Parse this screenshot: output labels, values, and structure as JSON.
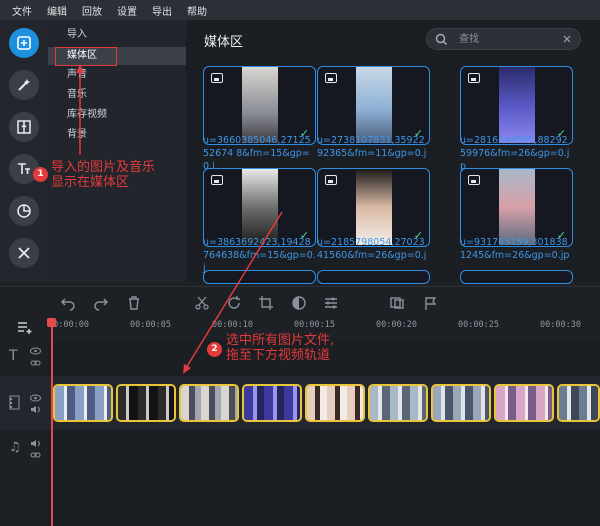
{
  "menu": [
    "文件",
    "编辑",
    "回放",
    "设置",
    "导出",
    "帮助"
  ],
  "categories": [
    "导入",
    "媒体区",
    "声音",
    "音乐",
    "库存视频",
    "背景"
  ],
  "media": {
    "title": "媒体区",
    "search_placeholder": "查找",
    "items": [
      {
        "caption": "u=3660385046,2712552674 8&fm=15&gp=0.j"
      },
      {
        "caption": "u=2738107831,3592292365&fm=11&gp=0.j"
      },
      {
        "caption": "u=2816544595,8829259976&fm=26&gp=0.jp"
      },
      {
        "caption": "u=3863692423,19428764638&fm=15&gp=0.j"
      },
      {
        "caption": "u=2185798054,2702341560&fm=26&gp=0.j"
      },
      {
        "caption": "u=931765159,3018381245&fm=26&gp=0.jp"
      }
    ]
  },
  "ruler": [
    "00:00:00",
    "00:00:05",
    "00:00:10",
    "00:00:15",
    "00:00:20",
    "00:00:25",
    "00:00:30"
  ],
  "annotations": {
    "a1": "导入的图片及音乐\n显示在媒体区",
    "a1_num": "1",
    "a2": "选中所有图片文件,\n拖至下方视频轨道",
    "a2_num": "2"
  },
  "colors": {
    "accent": "#1f8fe0",
    "annotation": "#e43a3a",
    "clip_border": "#e9c53a"
  }
}
